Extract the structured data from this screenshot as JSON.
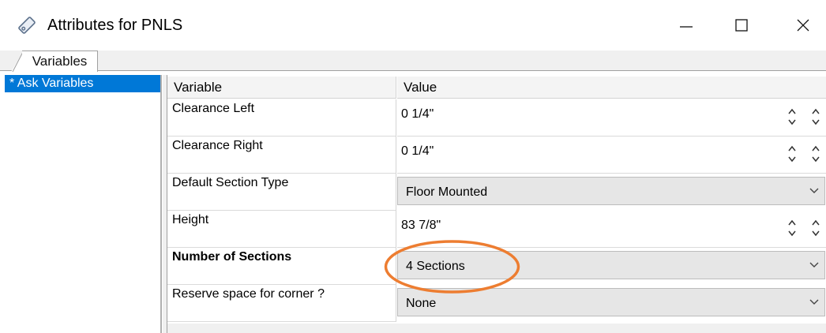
{
  "window": {
    "title": "Attributes for PNLS",
    "icon": "tag-icon",
    "controls": [
      "minimize-icon",
      "maximize-icon",
      "close-icon"
    ]
  },
  "tabs": [
    {
      "label": "Variables",
      "selected": true
    }
  ],
  "left_panel": {
    "items": [
      {
        "label": "* Ask Variables",
        "selected": true
      }
    ]
  },
  "grid": {
    "headers": {
      "variable": "Variable",
      "value": "Value"
    },
    "rows": [
      {
        "variable": "Clearance Left",
        "value": "0 1/4\"",
        "editor": "spinner",
        "bold": false
      },
      {
        "variable": "Clearance Right",
        "value": "0 1/4\"",
        "editor": "spinner",
        "bold": false
      },
      {
        "variable": "Default Section Type",
        "value": "Floor Mounted",
        "editor": "dropdown",
        "bold": false
      },
      {
        "variable": "Height",
        "value": "83 7/8\"",
        "editor": "spinner",
        "bold": false
      },
      {
        "variable": "Number of Sections",
        "value": "4 Sections",
        "editor": "dropdown",
        "bold": true
      },
      {
        "variable": "Reserve space for corner ?",
        "value": "None",
        "editor": "dropdown",
        "bold": false
      }
    ]
  },
  "colors": {
    "selection": "#0078d7",
    "highlight_ring": "#ed7d31"
  }
}
